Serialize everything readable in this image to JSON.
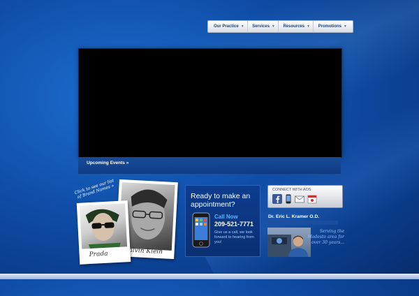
{
  "nav": {
    "items": [
      {
        "label": "Our Practice"
      },
      {
        "label": "Services"
      },
      {
        "label": "Resources"
      },
      {
        "label": "Promotions"
      }
    ]
  },
  "video": {
    "events_link": "Upcoming Events »"
  },
  "brands": {
    "note": "Click to see our list of Brand Names »",
    "photo1_caption": "Calvin Klein",
    "photo2_caption": "Prada"
  },
  "appointment": {
    "title": "Ready to make an appointment?",
    "call_label": "Call Now",
    "phone": "209-521-7771",
    "desc": "Give us a call, we look forward to hearing from you!"
  },
  "connect": {
    "label": "CONNECT WITH AOS",
    "icons": [
      "facebook-icon",
      "iphone-icon",
      "email-icon",
      "calendar-icon"
    ]
  },
  "doctor": {
    "name": "Dr. Eric L. Kramer O.D.",
    "serving": "Serving the Modesto area for over 30 years..."
  },
  "colors": {
    "accent": "#56b3ff",
    "background": "#0f4ea8"
  }
}
